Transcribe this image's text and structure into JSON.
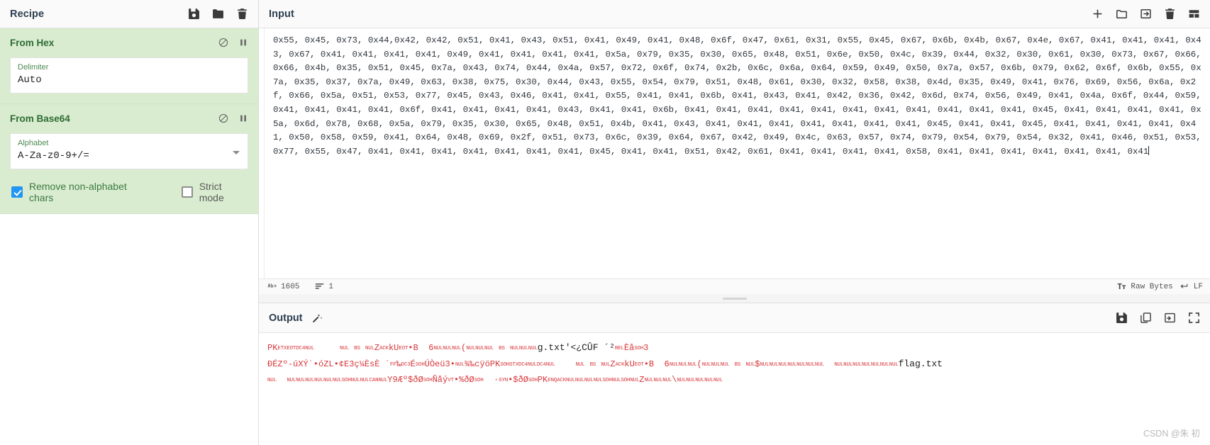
{
  "recipe": {
    "title": "Recipe",
    "toolbar": [
      {
        "name": "save-recipe-icon",
        "label": "save"
      },
      {
        "name": "load-recipe-icon",
        "label": "folder"
      },
      {
        "name": "clear-recipe-icon",
        "label": "trash"
      }
    ],
    "operations": [
      {
        "title": "From Hex",
        "disable_label": "disable",
        "pause_label": "pause",
        "args": [
          {
            "label": "Delimiter",
            "value": "Auto",
            "type": "select"
          }
        ],
        "checkboxes": []
      },
      {
        "title": "From Base64",
        "disable_label": "disable",
        "pause_label": "pause",
        "args": [
          {
            "label": "Alphabet",
            "value": "A-Za-z0-9+/=",
            "type": "select"
          }
        ],
        "checkboxes": [
          {
            "label": "Remove non-alphabet chars",
            "checked": true
          },
          {
            "label": "Strict mode",
            "checked": false
          }
        ]
      }
    ]
  },
  "input": {
    "title": "Input",
    "toolbar": [
      {
        "name": "add-input-tab-icon",
        "label": "add"
      },
      {
        "name": "open-folder-icon",
        "label": "open-folder"
      },
      {
        "name": "open-input-icon",
        "label": "open-input"
      },
      {
        "name": "clear-io-icon",
        "label": "clear"
      },
      {
        "name": "reset-layout-icon",
        "label": "reset-layout"
      }
    ],
    "text": "0x55, 0x45, 0x73, 0x44,0x42, 0x42, 0x51, 0x41, 0x43, 0x51, 0x41, 0x49, 0x41, 0x48, 0x6f, 0x47, 0x61, 0x31, 0x55, 0x45, 0x67, 0x6b, 0x4b, 0x67, 0x4e, 0x67, 0x41, 0x41, 0x41, 0x43, 0x67, 0x41, 0x41, 0x41, 0x41, 0x49, 0x41, 0x41, 0x41, 0x41, 0x5a, 0x79, 0x35, 0x30, 0x65, 0x48, 0x51, 0x6e, 0x50, 0x4c, 0x39, 0x44, 0x32, 0x30, 0x61, 0x30, 0x73, 0x67, 0x66, 0x66, 0x4b, 0x35, 0x51, 0x45, 0x7a, 0x43, 0x74, 0x44, 0x4a, 0x57, 0x72, 0x6f, 0x74, 0x2b, 0x6c, 0x6a, 0x64, 0x59, 0x49, 0x50, 0x7a, 0x57, 0x6b, 0x79, 0x62, 0x6f, 0x6b, 0x55, 0x7a, 0x35, 0x37, 0x7a, 0x49, 0x63, 0x38, 0x75, 0x30, 0x44, 0x43, 0x55, 0x54, 0x79, 0x51, 0x48, 0x61, 0x30, 0x32, 0x58, 0x38, 0x4d, 0x35, 0x49, 0x41, 0x76, 0x69, 0x56, 0x6a, 0x2f, 0x66, 0x5a, 0x51, 0x53, 0x77, 0x45, 0x43, 0x46, 0x41, 0x41, 0x55, 0x41, 0x41, 0x6b, 0x41, 0x43, 0x41, 0x42, 0x36, 0x42, 0x6d, 0x74, 0x56, 0x49, 0x41, 0x4a, 0x6f, 0x44, 0x59, 0x41, 0x41, 0x41, 0x41, 0x6f, 0x41, 0x41, 0x41, 0x41, 0x43, 0x41, 0x41, 0x6b, 0x41, 0x41, 0x41, 0x41, 0x41, 0x41, 0x41, 0x41, 0x41, 0x41, 0x41, 0x45, 0x41, 0x41, 0x41, 0x41, 0x5a, 0x6d, 0x78, 0x68, 0x5a, 0x79, 0x35, 0x30, 0x65, 0x48, 0x51, 0x4b, 0x41, 0x43, 0x41, 0x41, 0x41, 0x41, 0x41, 0x41, 0x41, 0x45, 0x41, 0x41, 0x45, 0x41, 0x41, 0x41, 0x41, 0x41, 0x50, 0x58, 0x59, 0x41, 0x64, 0x48, 0x69, 0x2f, 0x51, 0x73, 0x6c, 0x39, 0x64, 0x67, 0x42, 0x49, 0x4c, 0x63, 0x57, 0x74, 0x79, 0x54, 0x79, 0x54, 0x32, 0x41, 0x46, 0x51, 0x53, 0x77, 0x55, 0x47, 0x41, 0x41, 0x41, 0x41, 0x41, 0x41, 0x41, 0x45, 0x41, 0x41, 0x51, 0x42, 0x61, 0x41, 0x41, 0x41, 0x41, 0x58, 0x41, 0x41, 0x41, 0x41, 0x41, 0x41, 0x41",
    "status": {
      "length_icon": "abc-icon",
      "length": "1605",
      "lines_icon": "lines-icon",
      "lines": "1",
      "encoding_icon": "font-icon",
      "encoding": "Raw Bytes",
      "eol_icon": "enter-icon",
      "eol": "LF"
    }
  },
  "output": {
    "title": "Output",
    "magic_icon": "magic-wand-icon",
    "toolbar": [
      {
        "name": "save-output-icon",
        "label": "save"
      },
      {
        "name": "copy-output-icon",
        "label": "copy"
      },
      {
        "name": "replace-input-icon",
        "label": "replace-input"
      },
      {
        "name": "maximise-output-icon",
        "label": "maximise"
      }
    ],
    "lines": [
      "PK<c>ETX</c><c>EOT</c><c>DC4</c><c>NUL</c>     <c>NUL</c> <c>BS</c> <c>NUL</c>Z<c>ACK</c>kU<c>EOT</c>•B  6<c>NUL</c><c>NUL</c><c>NUL</c>(<c>NUL</c><c>NUL</c><c>NUL</c> <c>BS</c> <c>NUL</c><c>NUL</c><c>NUL</c><p>g.txt'<¿CÛF ´²</p><c>BEL</c>Èå<c>SOH</c>3",
      "ÐÉZº-úXÝ˙•óZL•¢E3ç¼ÈsÈ ´<c>FF</c>‰<c>DC3</c>É<c>SOH</c>ÚÒeü3•<c>NUL</c>¾‰cÿöPK<c>SOH</c><c>STX</c><c>DC4</c><c>NUL</c><c>DC4</c><c>NUL</c>    <c>NUL</c> <c>BS</c> <c>NUL</c>Z<c>ACK</c>kU<c>EOT</c>•B  6<c>NUL</c><c>NUL</c><c>NUL</c>(<c>NUL</c><c>NUL</c><c>NUL</c> <c>BS</c> <c>NUL</c>$<c>NUL</c><c>NUL</c><c>NUL</c><c>NUL</c><c>NUL</c><c>NUL</c><c>NUL</c>  <c>NUL</c><c>NUL</c><c>NUL</c><c>NUL</c><c>NUL</c><c>NUL</c><c>NUL</c><p>flag.txt</p>",
      "<c>NUL</c>  <c>NUL</c><c>NUL</c><c>NUL</c><c>NUL</c><c>NUL</c><c>NUL</c><c>SOH</c><c>NUL</c><c>NUL</c><c>CAN</c><c>NUL</c>Y9Æº$ðØ<c>SOH</c>Ñåý<c>VT</c>•%ðØ<c>SOH</c>  ·<c>SYN</c>•$ðØ<c>SOH</c>PK<c>ENQ</c><c>ACK</c><c>NUL</c><c>NUL</c><c>NUL</c><c>NUL</c><c>SOH</c><c>NUL</c><c>SOH</c><c>NUL</c>Z<c>NUL</c><c>NUL</c><c>NUL</c>\\<c>NUL</c><c>NUL</c><c>NUL</c><c>NUL</c><c>NUL</c>"
    ]
  },
  "watermark": "CSDN @朱 初"
}
